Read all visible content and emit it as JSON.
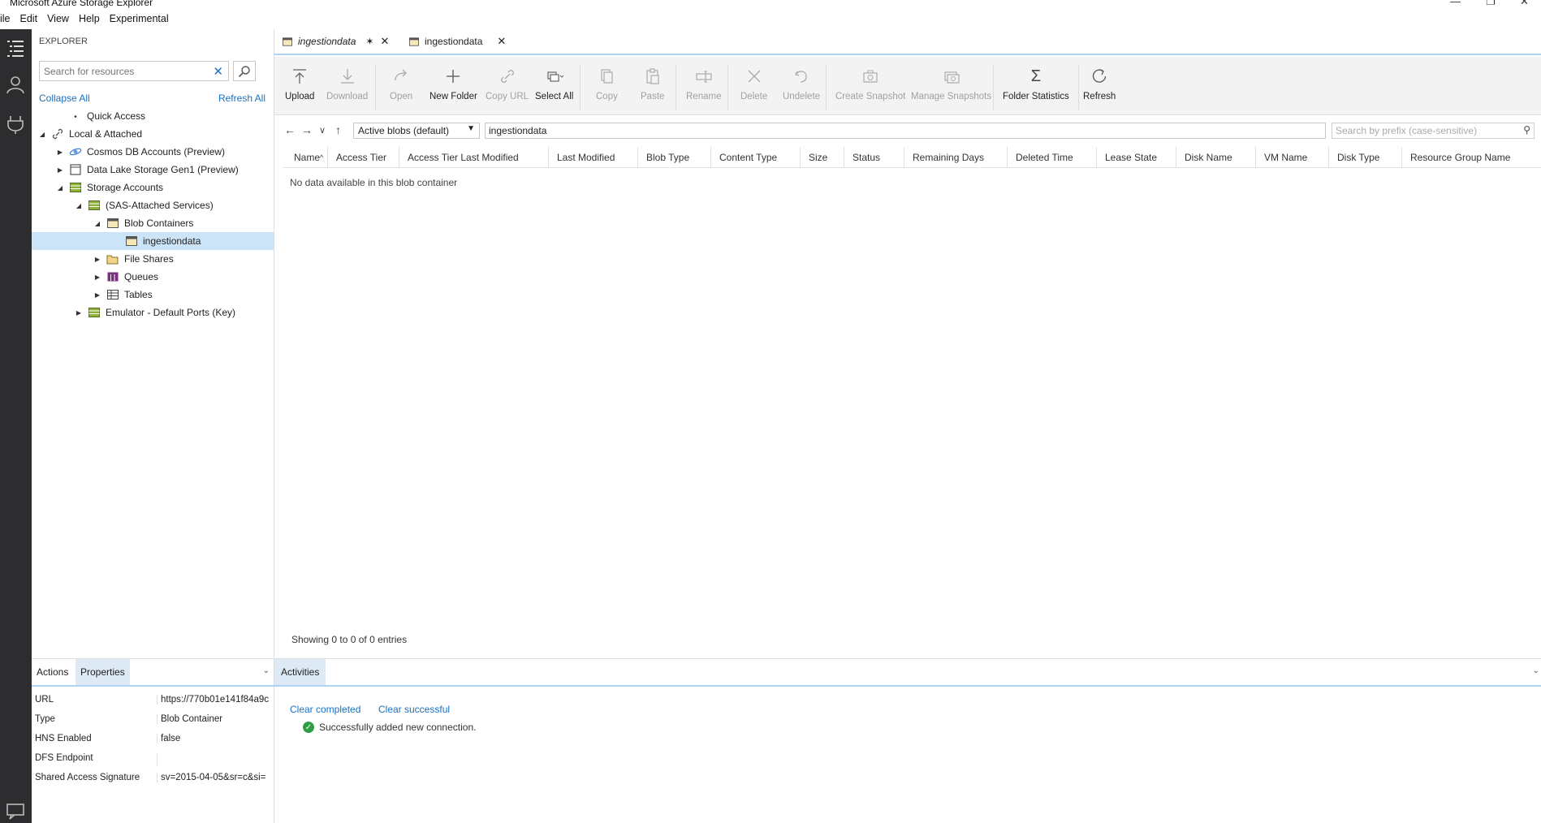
{
  "window": {
    "title": "Microsoft Azure Storage Explorer"
  },
  "menu": [
    "ile",
    "Edit",
    "View",
    "Help",
    "Experimental"
  ],
  "explorer": {
    "header": "EXPLORER",
    "search_placeholder": "Search for resources",
    "collapse_all": "Collapse All",
    "refresh_all": "Refresh All",
    "tree": [
      {
        "label": "Quick Access"
      },
      {
        "label": "Local & Attached"
      },
      {
        "label": "Cosmos DB Accounts (Preview)"
      },
      {
        "label": "Data Lake Storage Gen1 (Preview)"
      },
      {
        "label": "Storage Accounts"
      },
      {
        "label": "(SAS-Attached Services)"
      },
      {
        "label": "Blob Containers"
      },
      {
        "label": "ingestiondata"
      },
      {
        "label": "File Shares"
      },
      {
        "label": "Queues"
      },
      {
        "label": "Tables"
      },
      {
        "label": "Emulator - Default Ports (Key)"
      }
    ]
  },
  "tabs": [
    {
      "label": "ingestiondata"
    },
    {
      "label": "ingestiondata"
    }
  ],
  "toolbar": {
    "buttons": [
      {
        "label": "Upload",
        "icon": "upload-icon"
      },
      {
        "label": "Download",
        "icon": "download-icon"
      },
      {
        "label": "Open",
        "icon": "open-icon"
      },
      {
        "label": "New Folder",
        "icon": "plus-icon"
      },
      {
        "label": "Copy URL",
        "icon": "link-icon"
      },
      {
        "label": "Select All",
        "icon": "select-all-icon"
      },
      {
        "label": "Copy",
        "icon": "copy-icon"
      },
      {
        "label": "Paste",
        "icon": "paste-icon"
      },
      {
        "label": "Rename",
        "icon": "rename-icon"
      },
      {
        "label": "Delete",
        "icon": "delete-icon"
      },
      {
        "label": "Undelete",
        "icon": "undelete-icon"
      },
      {
        "label": "Create Snapshot",
        "icon": "camera-icon"
      },
      {
        "label": "Manage Snapshots",
        "icon": "snapshots-icon"
      },
      {
        "label": "Folder Statistics",
        "icon": "sigma-icon"
      },
      {
        "label": "Refresh",
        "icon": "refresh-icon"
      }
    ]
  },
  "pathbar": {
    "view_mode": "Active blobs (default)",
    "path": "ingestiondata",
    "prefix_placeholder": "Search by prefix (case-sensitive)"
  },
  "grid": {
    "columns": [
      "Name",
      "Access Tier",
      "Access Tier Last Modified",
      "Last Modified",
      "Blob Type",
      "Content Type",
      "Size",
      "Status",
      "Remaining Days",
      "Deleted Time",
      "Lease State",
      "Disk Name",
      "VM Name",
      "Disk Type",
      "Resource Group Name"
    ],
    "empty_message": "No data available in this blob container",
    "showing": "Showing 0 to 0 of 0 entries"
  },
  "bottom_left": {
    "tabs": [
      "Actions",
      "Properties"
    ],
    "properties": [
      {
        "key": "URL",
        "value": "https://770b01e141f84a9c"
      },
      {
        "key": "Type",
        "value": "Blob Container"
      },
      {
        "key": "HNS Enabled",
        "value": "false"
      },
      {
        "key": "DFS Endpoint",
        "value": ""
      },
      {
        "key": "Shared Access Signature",
        "value": "sv=2015-04-05&sr=c&si="
      }
    ]
  },
  "activities": {
    "tab": "Activities",
    "clear_completed": "Clear completed",
    "clear_successful": "Clear successful",
    "message": "Successfully added new connection."
  }
}
